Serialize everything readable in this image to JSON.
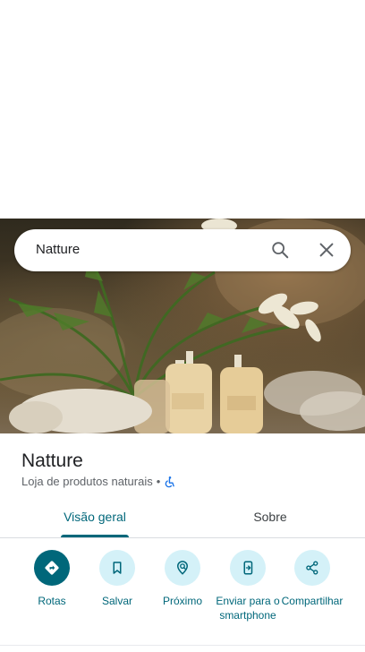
{
  "search": {
    "query": "Natture",
    "search_icon": "search-icon",
    "close_icon": "close-icon"
  },
  "place": {
    "name": "Natture",
    "category": "Loja de produtos naturais",
    "separator": "•",
    "accessibility_icon": "wheelchair-icon"
  },
  "tabs": [
    {
      "label": "Visão geral",
      "active": true
    },
    {
      "label": "Sobre",
      "active": false
    }
  ],
  "actions": [
    {
      "label": "Rotas",
      "icon": "directions-icon"
    },
    {
      "label": "Salvar",
      "icon": "bookmark-icon"
    },
    {
      "label": "Próximo",
      "icon": "nearby-icon"
    },
    {
      "label": "Enviar para o smartphone",
      "icon": "send-to-phone-icon"
    },
    {
      "label": "Compartilhar",
      "icon": "share-icon"
    }
  ],
  "colors": {
    "accent": "#00677a",
    "chip_bg": "#d4f1f8",
    "accessibility_blue": "#1a73e8"
  }
}
